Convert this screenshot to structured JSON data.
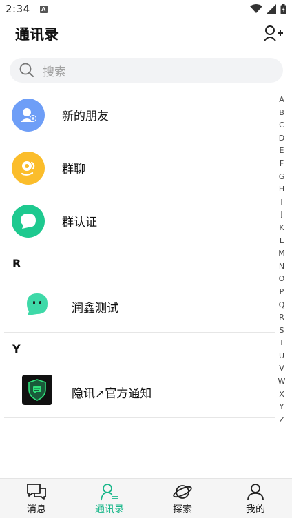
{
  "status": {
    "time": "2:34",
    "notif_glyph": "A"
  },
  "header": {
    "title": "通讯录",
    "add_contact_icon": "person-add-icon"
  },
  "search": {
    "placeholder": "搜索"
  },
  "features": [
    {
      "label": "新的朋友",
      "color": "#6e9ef7",
      "icon": "person-plus-icon"
    },
    {
      "label": "群聊",
      "color": "#fbbd2b",
      "icon": "group-chat-icon"
    },
    {
      "label": "群认证",
      "color": "#1ec98f",
      "icon": "group-verify-icon"
    }
  ],
  "sections": [
    {
      "letter": "R",
      "contacts": [
        {
          "name": "润鑫测试",
          "avatar": "green-bubble-avatar"
        }
      ]
    },
    {
      "letter": "Y",
      "contacts": [
        {
          "name": "隐讯↗官方通知",
          "avatar": "shield-chat-avatar"
        }
      ]
    }
  ],
  "index_letters": [
    "A",
    "B",
    "C",
    "D",
    "E",
    "F",
    "G",
    "H",
    "I",
    "J",
    "K",
    "L",
    "M",
    "N",
    "O",
    "P",
    "Q",
    "R",
    "S",
    "T",
    "U",
    "V",
    "W",
    "X",
    "Y",
    "Z"
  ],
  "tabs": [
    {
      "label": "消息",
      "icon": "chat-icon",
      "active": false
    },
    {
      "label": "通讯录",
      "icon": "contacts-icon",
      "active": true
    },
    {
      "label": "探索",
      "icon": "planet-icon",
      "active": false
    },
    {
      "label": "我的",
      "icon": "person-icon",
      "active": false
    }
  ],
  "colors": {
    "accent": "#19b78a",
    "search_bg": "#f2f3f5",
    "tabbar_bg": "#f5f5f5"
  }
}
